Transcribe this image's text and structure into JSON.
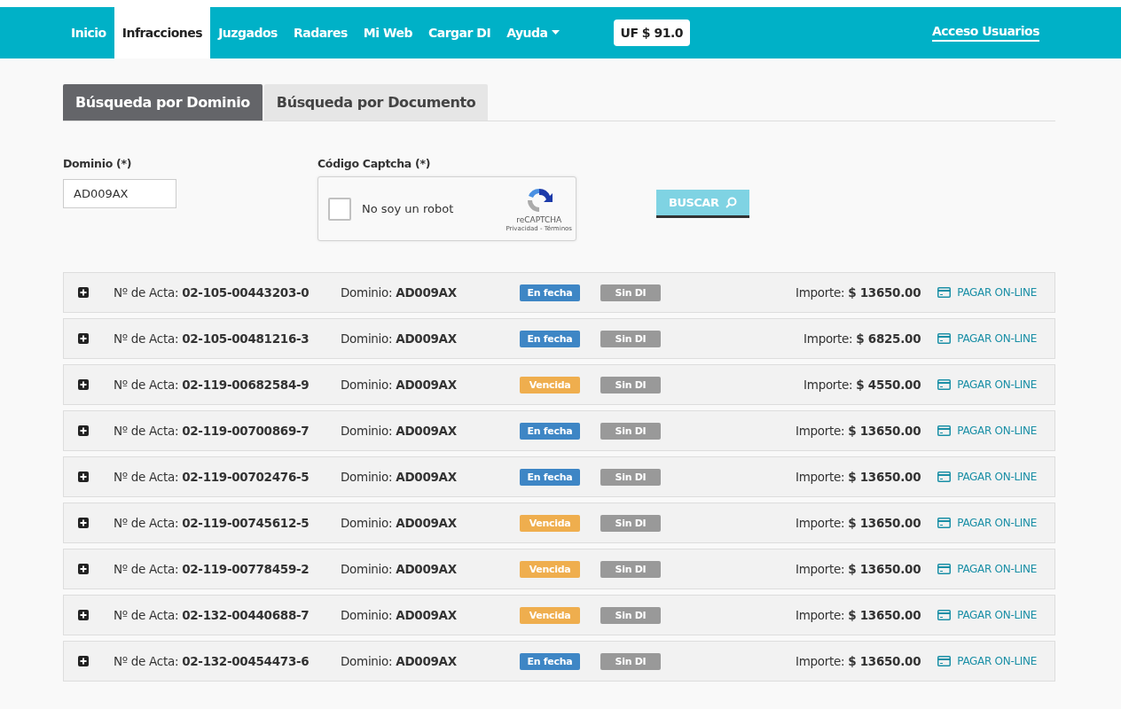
{
  "nav": {
    "items": [
      {
        "label": "Inicio",
        "selected": false,
        "dropdown": false
      },
      {
        "label": "Infracciones",
        "selected": true,
        "dropdown": false
      },
      {
        "label": "Juzgados",
        "selected": false,
        "dropdown": false
      },
      {
        "label": "Radares",
        "selected": false,
        "dropdown": false
      },
      {
        "label": "Mi Web",
        "selected": false,
        "dropdown": false
      },
      {
        "label": "Cargar DI",
        "selected": false,
        "dropdown": false
      },
      {
        "label": "Ayuda",
        "selected": false,
        "dropdown": true
      }
    ],
    "uf_badge": "UF $ 91.0",
    "login_link": "Acceso Usuarios"
  },
  "tabs": [
    {
      "label": "Búsqueda por Dominio",
      "selected": true
    },
    {
      "label": "Búsqueda por Documento",
      "selected": false
    }
  ],
  "form": {
    "domain_label": "Dominio (*)",
    "domain_value": "AD009AX",
    "captcha_label": "Código Captcha (*)",
    "captcha": {
      "checked": false,
      "text": "No soy un robot",
      "brand": "reCAPTCHA",
      "links": "Privacidad - Términos"
    },
    "search_button": "BUSCAR"
  },
  "rows": [
    {
      "acta": "Nº de Acta: **02-105-00443203-0**",
      "dominio": "Dominio: **AD009AX**",
      "status": {
        "kind": "en_fecha",
        "label": "En fecha"
      },
      "di": "Sin DI",
      "importe": "Importe: **$ 13650.00**",
      "pay": "PAGAR ON-LINE"
    },
    {
      "acta": "Nº de Acta: **02-105-00481216-3**",
      "dominio": "Dominio: **AD009AX**",
      "status": {
        "kind": "en_fecha",
        "label": "En fecha"
      },
      "di": "Sin DI",
      "importe": "Importe: **$ 6825.00**",
      "pay": "PAGAR ON-LINE"
    },
    {
      "acta": "Nº de Acta: **02-119-00682584-9**",
      "dominio": "Dominio: **AD009AX**",
      "status": {
        "kind": "vencida",
        "label": "Vencida"
      },
      "di": "Sin DI",
      "importe": "Importe: **$ 4550.00**",
      "pay": "PAGAR ON-LINE"
    },
    {
      "acta": "Nº de Acta: **02-119-00700869-7**",
      "dominio": "Dominio: **AD009AX**",
      "status": {
        "kind": "en_fecha",
        "label": "En fecha"
      },
      "di": "Sin DI",
      "importe": "Importe: **$ 13650.00**",
      "pay": "PAGAR ON-LINE"
    },
    {
      "acta": "Nº de Acta: **02-119-00702476-5**",
      "dominio": "Dominio: **AD009AX**",
      "status": {
        "kind": "en_fecha",
        "label": "En fecha"
      },
      "di": "Sin DI",
      "importe": "Importe: **$ 13650.00**",
      "pay": "PAGAR ON-LINE"
    },
    {
      "acta": "Nº de Acta: **02-119-00745612-5**",
      "dominio": "Dominio: **AD009AX**",
      "status": {
        "kind": "vencida",
        "label": "Vencida"
      },
      "di": "Sin DI",
      "importe": "Importe: **$ 13650.00**",
      "pay": "PAGAR ON-LINE"
    },
    {
      "acta": "Nº de Acta: **02-119-00778459-2**",
      "dominio": "Dominio: **AD009AX**",
      "status": {
        "kind": "vencida",
        "label": "Vencida"
      },
      "di": "Sin DI",
      "importe": "Importe: **$ 13650.00**",
      "pay": "PAGAR ON-LINE"
    },
    {
      "acta": "Nº de Acta: **02-132-00440688-7**",
      "dominio": "Dominio: **AD009AX**",
      "status": {
        "kind": "vencida",
        "label": "Vencida"
      },
      "di": "Sin DI",
      "importe": "Importe: **$ 13650.00**",
      "pay": "PAGAR ON-LINE"
    },
    {
      "acta": "Nº de Acta: **02-132-00454473-6**",
      "dominio": "Dominio: **AD009AX**",
      "status": {
        "kind": "en_fecha",
        "label": "En fecha"
      },
      "di": "Sin DI",
      "importe": "Importe: **$ 13650.00**",
      "pay": "PAGAR ON-LINE"
    }
  ]
}
